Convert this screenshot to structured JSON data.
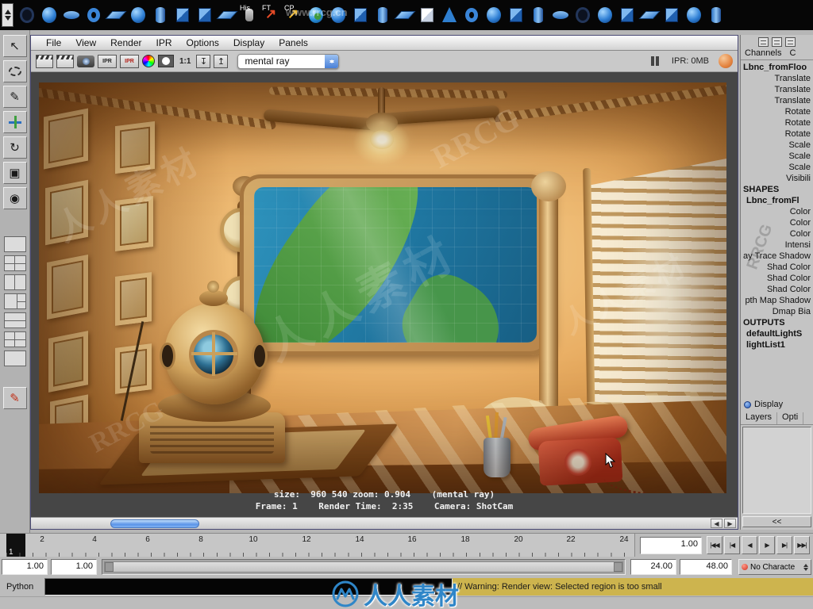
{
  "watermark": {
    "cn": "人人素材",
    "en": "RRCG",
    "url": "www.rrcg.cn"
  },
  "shelf": {
    "labels": {
      "his": "His",
      "ft": "FT",
      "cp": "CP"
    }
  },
  "render_view": {
    "menus": [
      "File",
      "View",
      "Render",
      "IPR",
      "Options",
      "Display",
      "Panels"
    ],
    "toolbar": {
      "renderer": "mental ray",
      "ratio": "1:1",
      "ipr_icon": "IPR",
      "ipr_memory": "IPR: 0MB"
    },
    "status1": "size:  960 540 zoom: 0.904    (mental ray)",
    "status2": "Frame: 1    Render Time:  2:35    Camera: ShotCam"
  },
  "channel_box": {
    "tab": "Channels",
    "tab2": "C",
    "object": "Lbnc_fromFloo",
    "transform_attrs": [
      "Translate",
      "Translate",
      "Translate",
      "Rotate",
      "Rotate",
      "Rotate",
      "Scale",
      "Scale",
      "Scale",
      "Visibili"
    ],
    "shapes_header": "SHAPES",
    "shape_node": "Lbnc_fromFl",
    "shape_attrs": [
      "Color",
      "Color",
      "Color",
      "Intensi",
      "ay Trace Shadow",
      "Shad Color",
      "Shad Color",
      "Shad Color",
      "pth Map Shadow",
      "Dmap Bia"
    ],
    "outputs_header": "OUTPUTS",
    "outputs": [
      "defaultLightS",
      "lightList1"
    ],
    "display_label": "Display",
    "layers_tab": "Layers",
    "options_tab": "Opti",
    "collapse": "<<"
  },
  "timeline": {
    "current_frame": "1",
    "ticks": [
      "2",
      "4",
      "6",
      "8",
      "10",
      "12",
      "14",
      "16",
      "18",
      "20",
      "22",
      "24"
    ],
    "time_field": "1.00",
    "playback": [
      "|◀◀",
      "|◀",
      "◀",
      "▶",
      "▶|",
      "▶▶|"
    ]
  },
  "range_slider": {
    "f1": "1.00",
    "f2": "1.00",
    "f3": "24.00",
    "f4": "48.00",
    "character": "No Characte"
  },
  "command_line": {
    "language": "Python",
    "warning": "// Warning: Render view: Selected region is too small"
  }
}
